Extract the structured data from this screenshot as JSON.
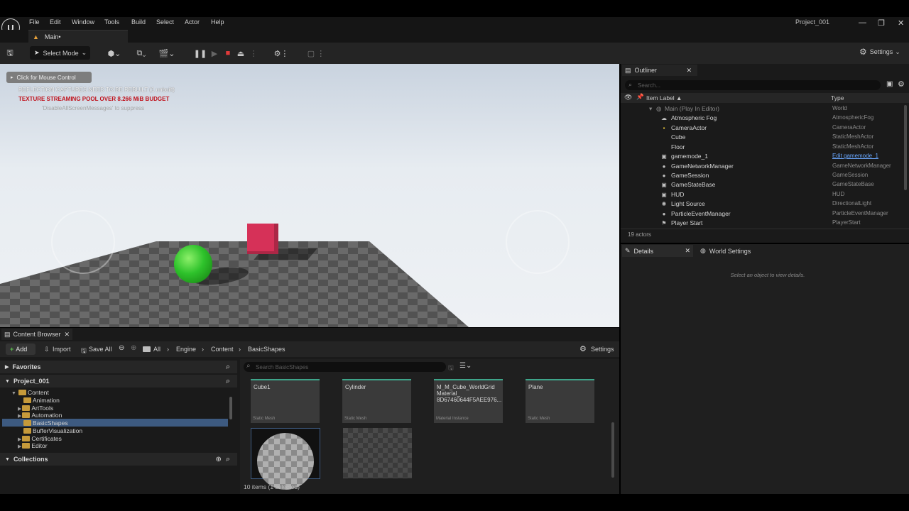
{
  "app": {
    "menu": [
      "File",
      "Edit",
      "Window",
      "Tools",
      "Build",
      "Select",
      "Actor",
      "Help"
    ],
    "project_name": "Project_001",
    "main_tab": "Main•",
    "window_controls": [
      "—",
      "❐",
      "✕"
    ]
  },
  "toolbar": {
    "select_mode": "Select Mode",
    "settings": "Settings"
  },
  "viewport": {
    "mouse_control": "Click for Mouse Control",
    "msg_reflection": "REFLECTION CAPTURES NEED TO BE REBUILT (1 unbuilt)",
    "msg_texture": "TEXTURE STREAMING POOL OVER 8.266 MiB BUDGET",
    "msg_suppress": "'DisableAllScreenMessages' to suppress"
  },
  "outliner": {
    "tab": "Outliner",
    "search_placeholder": "Search...",
    "col_label": "Item Label ▲",
    "col_type": "Type",
    "root": {
      "label": "Main (Play In Editor)",
      "type": "World"
    },
    "rows": [
      {
        "label": "Atmospheric Fog",
        "type": "AtmosphericFog",
        "icon": "☁"
      },
      {
        "label": "CameraActor",
        "type": "CameraActor",
        "icon": "▪"
      },
      {
        "label": "Cube",
        "type": "StaticMeshActor",
        "icon": ""
      },
      {
        "label": "Floor",
        "type": "StaticMeshActor",
        "icon": ""
      },
      {
        "label": "gamemode_1",
        "type": "Edit gamemode_1",
        "icon": "▣"
      },
      {
        "label": "GameNetworkManager",
        "type": "GameNetworkManager",
        "icon": "●"
      },
      {
        "label": "GameSession",
        "type": "GameSession",
        "icon": "●"
      },
      {
        "label": "GameStateBase",
        "type": "GameStateBase",
        "icon": "▣"
      },
      {
        "label": "HUD",
        "type": "HUD",
        "icon": "▣"
      },
      {
        "label": "Light Source",
        "type": "DirectionalLight",
        "icon": "✺"
      },
      {
        "label": "ParticleEventManager",
        "type": "ParticleEventManager",
        "icon": "●"
      },
      {
        "label": "Player Start",
        "type": "PlayerStart",
        "icon": "⚑"
      }
    ],
    "actors_count": "19 actors"
  },
  "details": {
    "tab": "Details",
    "world_tab": "World Settings",
    "empty_msg": "Select an object to view details."
  },
  "content_browser": {
    "tab": "Content Browser",
    "add": "Add",
    "import": "Import",
    "save_all": "Save All",
    "path": [
      "All",
      "Engine",
      "Content",
      "BasicShapes"
    ],
    "settings": "Settings",
    "favorites": "Favorites",
    "project": "Project_001",
    "collections": "Collections",
    "tree": [
      "Content",
      "Animation",
      "ArtTools",
      "Automation",
      "BasicShapes",
      "BufferVisualization",
      "Certificates",
      "Editor"
    ],
    "search_placeholder": "Search BasicShapes",
    "tiles": [
      {
        "name": "Cube1",
        "type": "Static Mesh"
      },
      {
        "name": "Cylinder",
        "type": "Static Mesh"
      },
      {
        "name": "M_M_Cube_WorldGrid Material_ 8D67460644F5AEE976...",
        "type": "Material Instance"
      },
      {
        "name": "Plane",
        "type": "Static Mesh"
      }
    ],
    "items_count": "10 items (1 selected)"
  },
  "colors": {
    "accent_tab": "#3ea58a",
    "warning_red": "#c0101a",
    "selection": "#3d5a80"
  }
}
